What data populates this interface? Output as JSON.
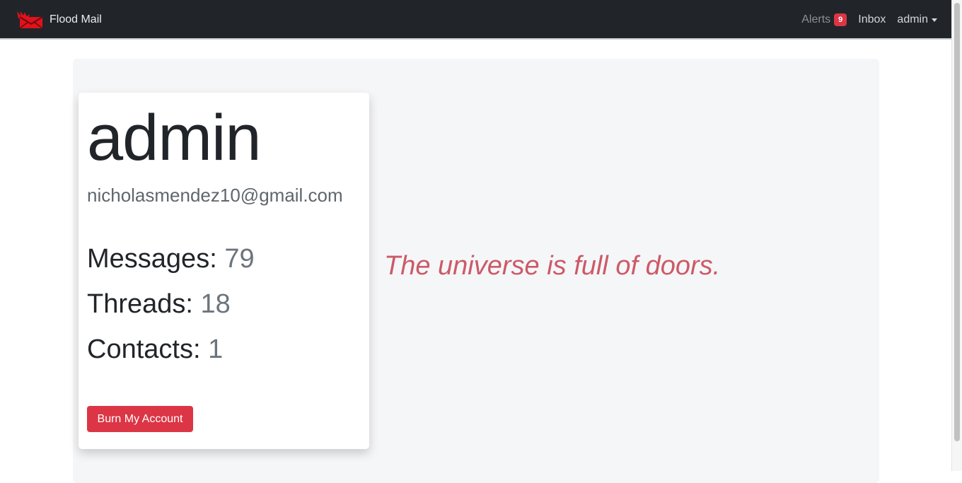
{
  "navbar": {
    "brand_name": "Flood Mail",
    "alerts_label": "Alerts",
    "alerts_count": "9",
    "inbox_label": "Inbox",
    "user_menu_label": "admin"
  },
  "profile": {
    "username": "admin",
    "email": "nicholasmendez10@gmail.com",
    "stats": {
      "messages_label": "Messages:",
      "messages_value": "79",
      "threads_label": "Threads:",
      "threads_value": "18",
      "contacts_label": "Contacts:",
      "contacts_value": "1"
    },
    "burn_button_label": "Burn My Account"
  },
  "quote": "The universe is full of doors.",
  "colors": {
    "navbar_bg": "#212529",
    "danger": "#dc3545",
    "quote": "#cc5a67",
    "jumbotron_bg": "#f5f6f8"
  }
}
